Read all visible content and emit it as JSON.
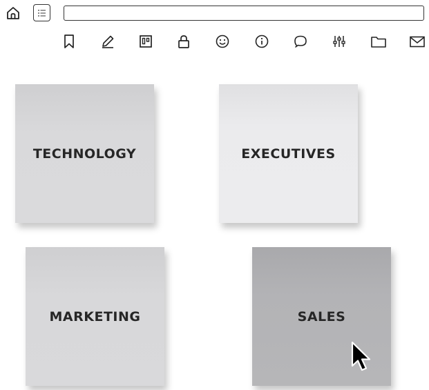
{
  "topbar": {
    "home_icon": "home-icon",
    "list_icon": "list-icon",
    "address_value": ""
  },
  "toolbar": {
    "icons": [
      "bookmark-icon",
      "pencil-icon",
      "board-icon",
      "lock-icon",
      "smiley-icon",
      "info-icon",
      "comment-icon",
      "sliders-icon",
      "folder-icon",
      "mail-icon"
    ]
  },
  "notes": [
    {
      "label": "TECHNOLOGY",
      "color": "#d9d9db"
    },
    {
      "label": "EXECUTIVES",
      "color": "#ebebed"
    },
    {
      "label": "MARKETING",
      "color": "#d8d8da"
    },
    {
      "label": "SALES",
      "color": "#b3b3b6"
    }
  ],
  "cursor": "arrow-cursor-icon"
}
